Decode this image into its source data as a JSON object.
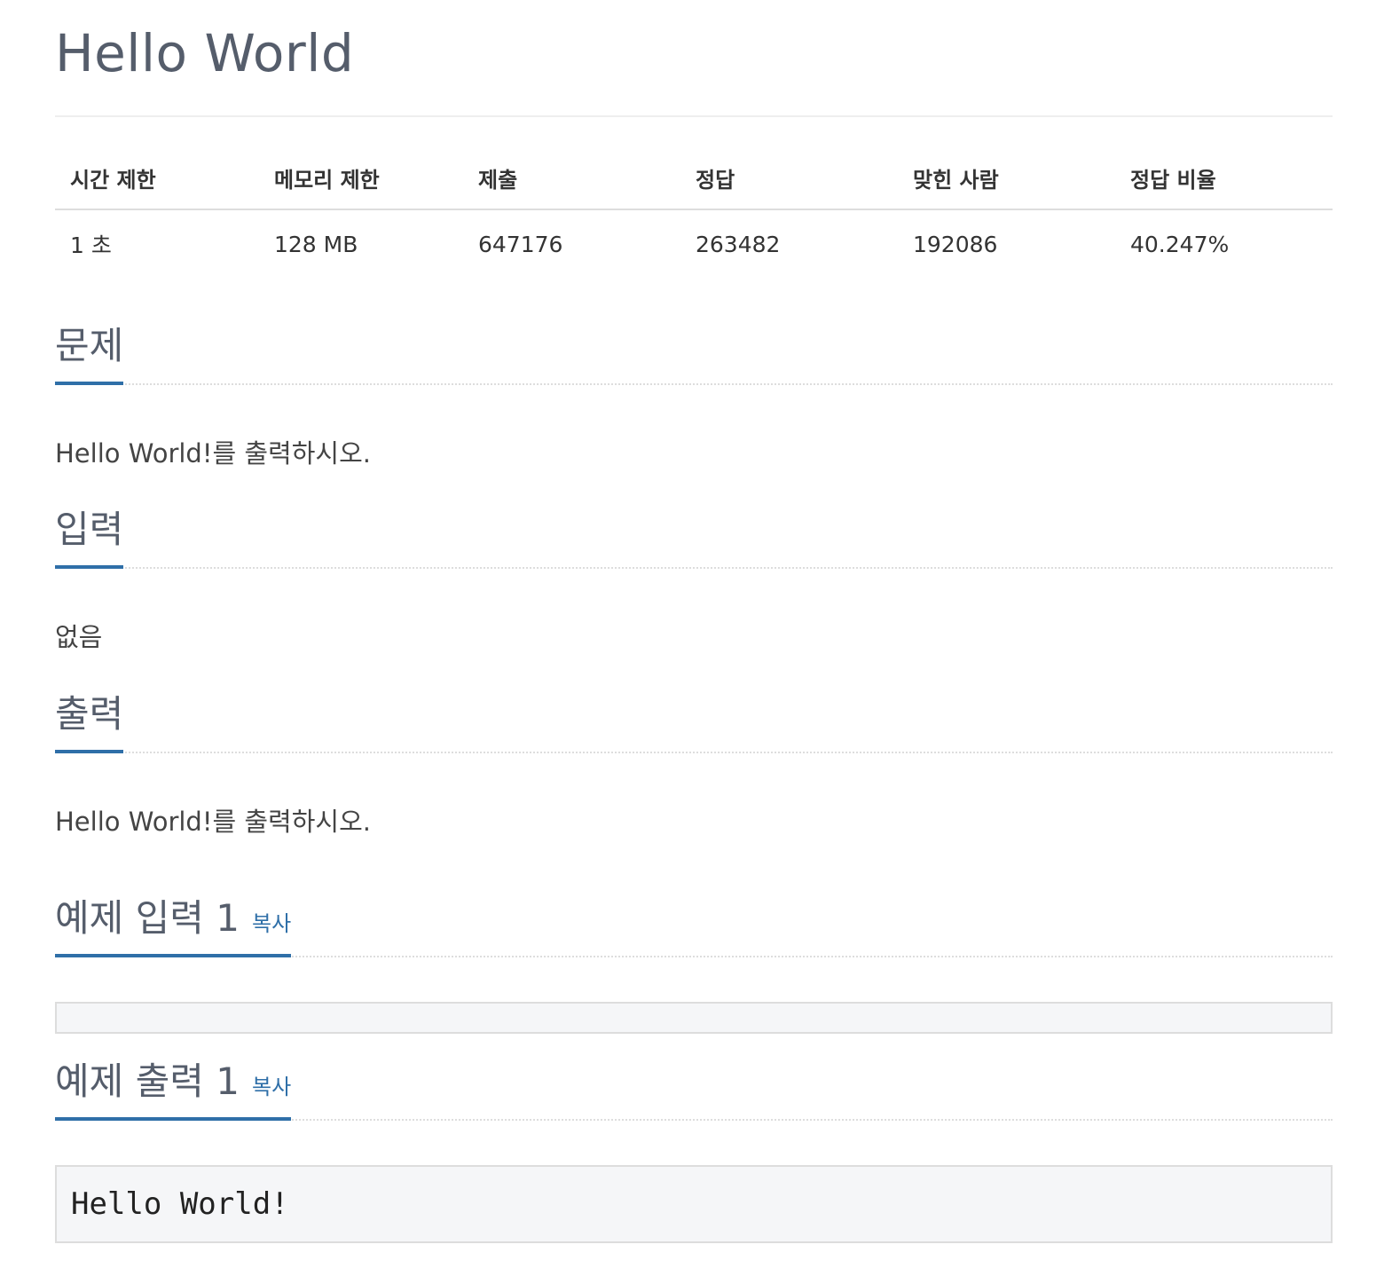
{
  "problem": {
    "title": "Hello World"
  },
  "info_table": {
    "headers": [
      "시간 제한",
      "메모리 제한",
      "제출",
      "정답",
      "맞힌 사람",
      "정답 비율"
    ],
    "values": [
      "1 초",
      "128 MB",
      "647176",
      "263482",
      "192086",
      "40.247%"
    ]
  },
  "sections": {
    "description": {
      "heading": "문제",
      "text": "Hello World!를 출력하시오."
    },
    "input": {
      "heading": "입력",
      "text": "없음"
    },
    "output": {
      "heading": "출력",
      "text": "Hello World!를 출력하시오."
    },
    "sample_input": {
      "heading": "예제 입력 1",
      "copy_label": "복사",
      "content": ""
    },
    "sample_output": {
      "heading": "예제 출력 1",
      "copy_label": "복사",
      "content": "Hello World!"
    }
  },
  "colors": {
    "accent": "#2f6fa8",
    "heading": "#555d6b",
    "sample_bg": "#f5f6f8"
  }
}
